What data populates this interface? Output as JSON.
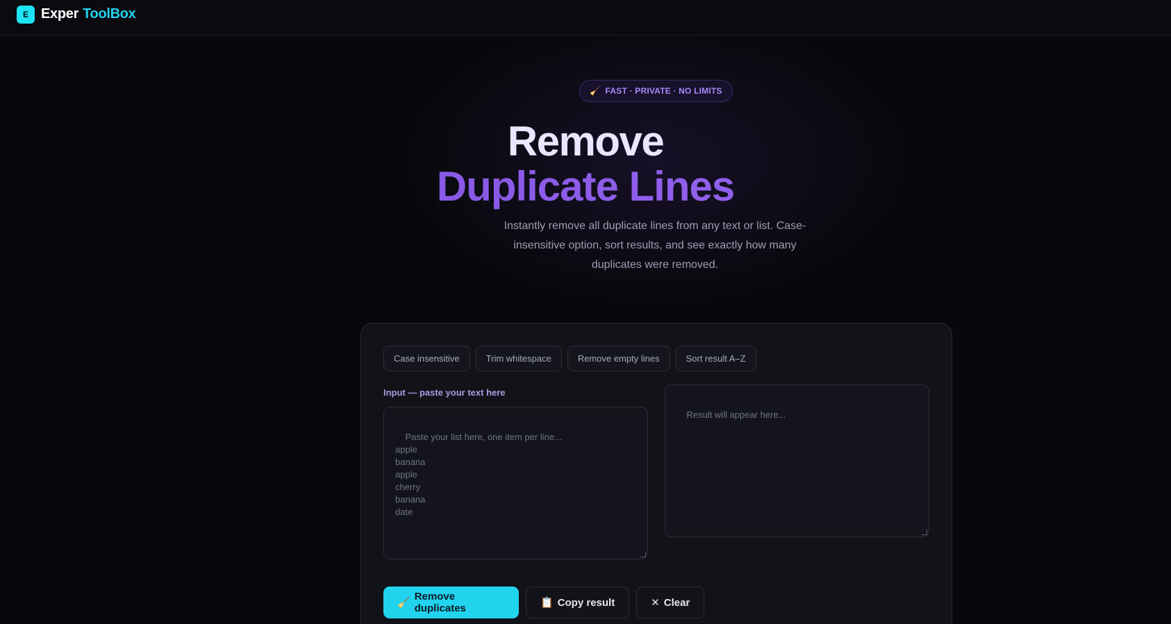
{
  "header": {
    "logo_letter": "E",
    "brand_part1": "Exper",
    "brand_part2": "ToolBox"
  },
  "hero": {
    "badge_icon": "🧹",
    "badge_text": "FAST · PRIVATE · NO LIMITS",
    "title_line1": "Remove",
    "title_line2": "Duplicate Lines",
    "subtitle": "Instantly remove all duplicate lines from any text or list. Case-insensitive option, sort results, and see exactly how many duplicates were removed."
  },
  "options": {
    "case_insensitive": "Case insensitive",
    "trim_whitespace": "Trim whitespace",
    "remove_empty": "Remove empty lines",
    "sort_result": "Sort result A–Z"
  },
  "input": {
    "label": "Input — paste your text here",
    "placeholder": "Paste your list here, one item per line...\napple\nbanana\napple\ncherry\nbanana\ndate"
  },
  "result": {
    "placeholder": "Result will appear here..."
  },
  "actions": {
    "remove_icon": "🧹",
    "remove_label": "Remove duplicates",
    "copy_icon": "📋",
    "copy_label": "Copy result",
    "clear_icon": "✕",
    "clear_label": "Clear"
  },
  "colors": {
    "accent_cyan": "#22d3ee",
    "accent_purple": "#8b5cf6",
    "background": "#08080c"
  }
}
